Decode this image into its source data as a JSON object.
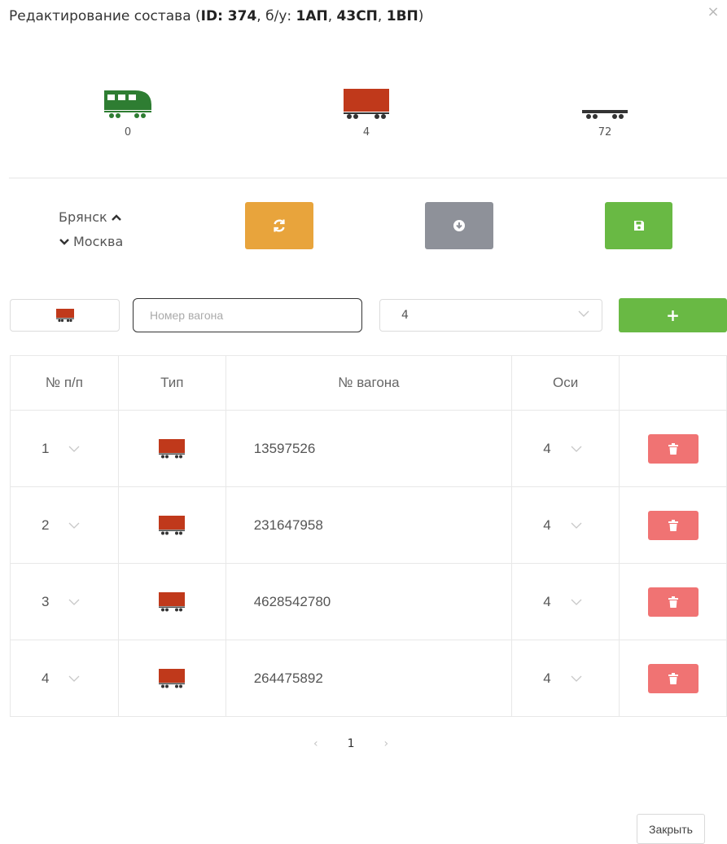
{
  "dialog": {
    "title_prefix": "Редактирование состава (",
    "title_id": "ID: 374",
    "title_sep1": ", б/у: ",
    "title_ap": "1АП",
    "title_sep2": ", ",
    "title_sp": "43СП",
    "title_sep3": ", ",
    "title_vp": "1ВП",
    "title_suffix": ")",
    "close_glyph": "×"
  },
  "stats": {
    "locomotives": "0",
    "wagons": "4",
    "platforms": "72"
  },
  "route": {
    "from": "Брянск",
    "to": "Москва"
  },
  "add_form": {
    "number_placeholder": "Номер вагона",
    "axles_value": "4",
    "add_label": "+"
  },
  "table": {
    "headers": [
      "№ п/п",
      "Тип",
      "№ вагона",
      "Оси",
      ""
    ],
    "rows": [
      {
        "index": "1",
        "number": "13597526",
        "axles": "4"
      },
      {
        "index": "2",
        "number": "231647958",
        "axles": "4"
      },
      {
        "index": "3",
        "number": "4628542780",
        "axles": "4"
      },
      {
        "index": "4",
        "number": "264475892",
        "axles": "4"
      }
    ]
  },
  "pagination": {
    "prev": "‹",
    "current": "1",
    "next": "›"
  },
  "footer": {
    "close_label": "Закрыть"
  },
  "colors": {
    "locomotive": "#2e7d32",
    "wagon": "#c0391b",
    "platform": "#333333",
    "orange": "#e8a43c",
    "gray": "#8e9199",
    "green": "#69b944",
    "danger": "#f07373"
  }
}
